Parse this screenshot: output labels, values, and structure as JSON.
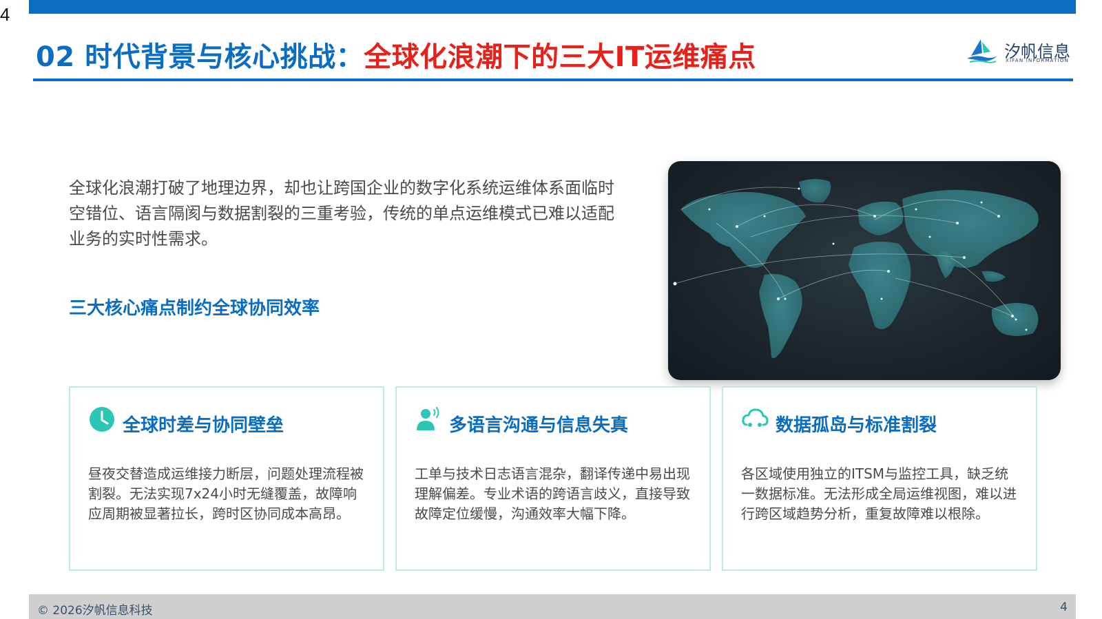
{
  "corner_number": "4",
  "header": {
    "title_part1": "02 时代背景与核心挑战：",
    "title_part2": "全球化浪潮下的三大IT运维痛点"
  },
  "logo": {
    "name": "汐帆信息",
    "subtitle": "XIFAN INFORMATION",
    "icon": "sailboat-logo-icon"
  },
  "intro_text": "全球化浪潮打破了地理边界，却也让跨国企业的数字化系统运维体系面临时空错位、语言隔阂与数据割裂的三重考验，传统的单点运维模式已难以适配业务的实时性需求。",
  "section_heading": "三大核心痛点制约全球协同效率",
  "image": {
    "description_icon": "world-map-network-image"
  },
  "cards": [
    {
      "icon": "clock-icon",
      "title": "全球时差与协同壁垒",
      "text": "昼夜交替造成运维接力断层，问题处理流程被割裂。无法实现7x24小时无缝覆盖，故障响应周期被显著拉长，跨时区协同成本高昂。"
    },
    {
      "icon": "speaking-person-icon",
      "title": "多语言沟通与信息失真",
      "text": "工单与技术日志语言混杂，翻译传递中易出现理解偏差。专业术语的跨语言歧义，直接导致故障定位缓慢，沟通效率大幅下降。"
    },
    {
      "icon": "disconnected-cloud-icon",
      "title": "数据孤岛与标准割裂",
      "text": "各区域使用独立的ITSM与监控工具，缺乏统一数据标准。无法形成全局运维视图，难以进行跨区域趋势分析，重复故障难以根除。"
    }
  ],
  "footer": {
    "copyright": "© 2026汐帆信息科技",
    "page_number": "4"
  },
  "colors": {
    "primary_blue": "#0b6dc1",
    "accent_red": "#e8201a",
    "teal_icon": "#2cc7b4",
    "card_border": "#bfe9e5",
    "footer_bg": "#cfcfcf"
  }
}
